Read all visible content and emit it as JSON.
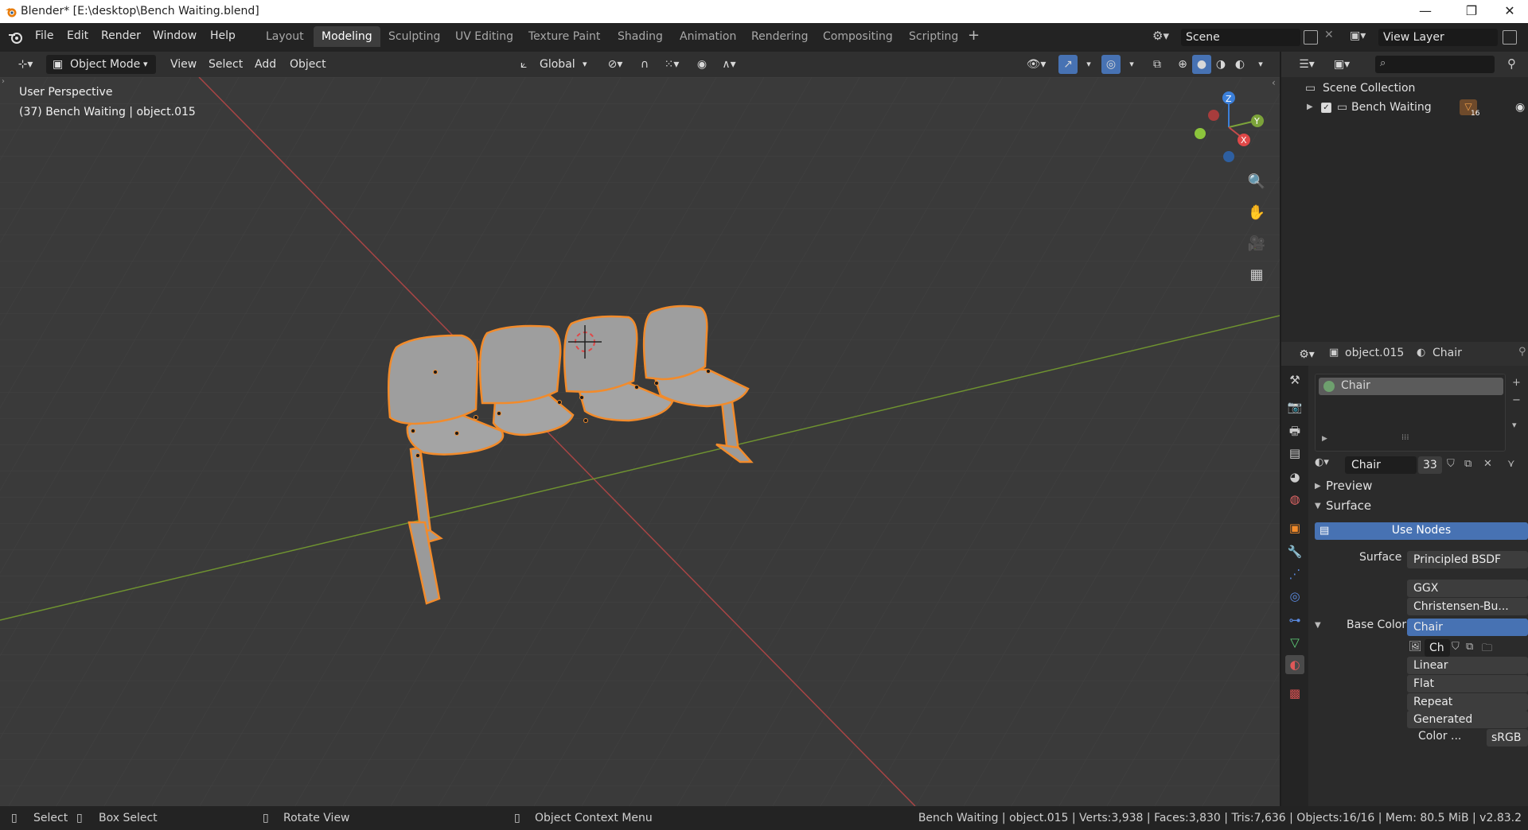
{
  "window": {
    "title": "Blender* [E:\\desktop\\Bench Waiting.blend]",
    "minimize": "—",
    "maximize": "❐",
    "close": "✕"
  },
  "menu": {
    "items": [
      "File",
      "Edit",
      "Render",
      "Window",
      "Help"
    ]
  },
  "workspaces": {
    "tabs": [
      "Layout",
      "Modeling",
      "Sculpting",
      "UV Editing",
      "Texture Paint",
      "Shading",
      "Animation",
      "Rendering",
      "Compositing",
      "Scripting"
    ],
    "active": "Modeling",
    "add": "+"
  },
  "scene": {
    "name": "Scene",
    "view_layer": "View Layer"
  },
  "viewport_header": {
    "mode": "Object Mode",
    "view": "View",
    "select": "Select",
    "add": "Add",
    "object": "Object",
    "orientation": "Global"
  },
  "viewport": {
    "perspective": "User Perspective",
    "info": "(37) Bench Waiting | object.015",
    "gizmo": {
      "z": "Z",
      "y": "Y",
      "x": "X"
    }
  },
  "outliner": {
    "search_placeholder": "",
    "root": "Scene Collection",
    "collection": "Bench Waiting",
    "collection_count": "16"
  },
  "properties": {
    "object_name": "object.015",
    "material_name": "Chair",
    "slot_name": "Chair",
    "material_field": "Chair",
    "users": "33",
    "preview_label": "Preview",
    "surface_label": "Surface",
    "use_nodes": "Use Nodes",
    "surface_field_label": "Surface",
    "surface_value": "Principled BSDF",
    "distribution": "GGX",
    "subsurface": "Christensen-Bu...",
    "base_color_label": "Base Color",
    "base_color_value": "Chair",
    "image_short": "Ch",
    "interpolation": "Linear",
    "projection": "Flat",
    "extension": "Repeat",
    "vector": "Generated",
    "color_label": "Color ...",
    "color_space": "sRGB"
  },
  "statusbar": {
    "select": "Select",
    "box_select": "Box Select",
    "rotate_view": "Rotate View",
    "context_menu": "Object Context Menu",
    "stats": "Bench Waiting | object.015 | Verts:3,938 | Faces:3,830 | Tris:7,636 | Objects:16/16 | Mem: 80.5 MiB | v2.83.2"
  },
  "colors": {
    "accent_blue": "#4772b3",
    "selection_orange": "#f28b2b",
    "axis_x": "#c44b4b",
    "axis_y": "#7ca33a",
    "axis_z": "#3b7fd9"
  }
}
